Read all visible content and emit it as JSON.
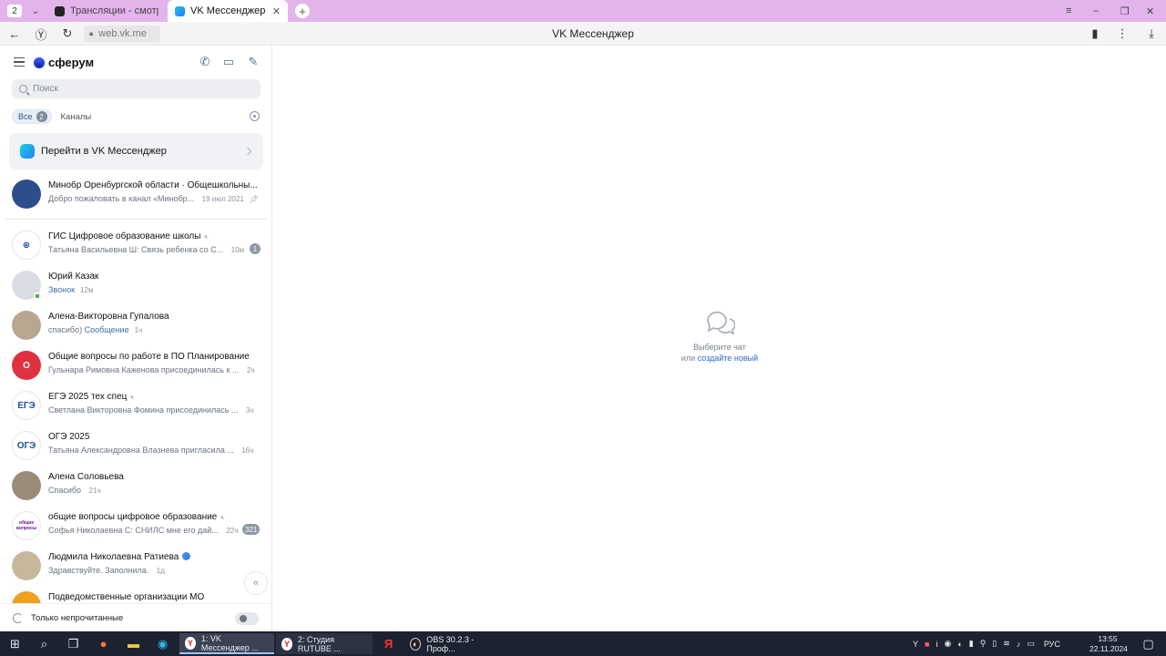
{
  "browser": {
    "tab_counter": "2",
    "tabs": [
      {
        "title": "Трансляции - смотреть в"
      },
      {
        "title": "VK Мессенджер"
      }
    ],
    "url": "web.vk.me",
    "page_title": "VK Мессенджер"
  },
  "sidebar": {
    "brand": "сферум",
    "search_placeholder": "Поиск",
    "filters": {
      "all_label": "Все",
      "all_count": "2",
      "channels_label": "Каналы"
    },
    "promo_label": "Перейти в VK Мессенджер",
    "chats": [
      {
        "name": "Минобр Оренбургской области · Общешкольны...",
        "preview": "Добро пожаловать в канал «Минобр...",
        "time": "19 июл 2021",
        "pinned": true,
        "avatar_color": "#2d4e8a",
        "avatar_text": ""
      },
      {
        "name": "ГИС Цифровое образование школы",
        "preview": "Татьяна Васильевна Ш: Связь ребенка со С...",
        "time": "10м",
        "badge": "1",
        "muted": true,
        "avatar_color": "#ffffff",
        "avatar_text": "⊕"
      },
      {
        "name": "Юрий Казак",
        "preview_blue": "Звонок",
        "preview": "",
        "time": "12м",
        "online": true,
        "avatar_color": "#d9dde3",
        "avatar_text": ""
      },
      {
        "name": "Алена-Викторовна Гупалова",
        "preview": "спасибо)",
        "preview_blue": "Сообщение",
        "time": "1ч",
        "avatar_color": "#b9a690",
        "avatar_text": ""
      },
      {
        "name": "Общие вопросы по работе в ПО Планирование",
        "preview": "Гульнара Римовна Каженова присоединилась к ...",
        "time": "2ч",
        "avatar_color": "#e03141",
        "avatar_text": "О"
      },
      {
        "name": "ЕГЭ 2025 тех спец",
        "preview": "Светлана Викторовна Фомина присоединилась ...",
        "time": "3ч",
        "muted": true,
        "avatar_color": "#ffffff",
        "avatar_text": "ЕГЭ"
      },
      {
        "name": "ОГЭ 2025",
        "preview": "Татьяна Александровна Влазнева пригласила ...",
        "time": "16ч",
        "avatar_color": "#ffffff",
        "avatar_text": "ОГЭ"
      },
      {
        "name": "Алена Соловьева",
        "preview": "Спасибо",
        "time": "21ч",
        "avatar_color": "#9b8c78",
        "avatar_text": ""
      },
      {
        "name": "общие вопросы цифровое образование",
        "preview": "Софья Николаевна С: СНИЛС мне его дай...",
        "time": "22ч",
        "badge": "321",
        "muted": true,
        "avatar_color": "#ffffff",
        "avatar_text": "общие вопросы"
      },
      {
        "name": "Людмила Николаевна Ратиева",
        "preview": "Здравствуйте. Заполнила.",
        "time": "1д",
        "verified": true,
        "avatar_color": "#c8b79b",
        "avatar_text": ""
      },
      {
        "name": "Подведомственные организации МО",
        "preview": "",
        "time": "",
        "avatar_color": "#f0a020",
        "avatar_text": ""
      }
    ],
    "footer_label": "Только непрочитанные"
  },
  "main": {
    "empty_line1": "Выберите чат",
    "empty_line2_prefix": "или",
    "empty_line2_link": "создайте новый"
  },
  "taskbar": {
    "apps": [
      {
        "label": "1: VK Мессенджер ..."
      },
      {
        "label": "2: Студия RUTUBE ..."
      },
      {
        "label": "OBS 30.2.3 - Проф..."
      }
    ],
    "lang": "РУС",
    "time": "13:55",
    "date": "22.11.2024"
  }
}
